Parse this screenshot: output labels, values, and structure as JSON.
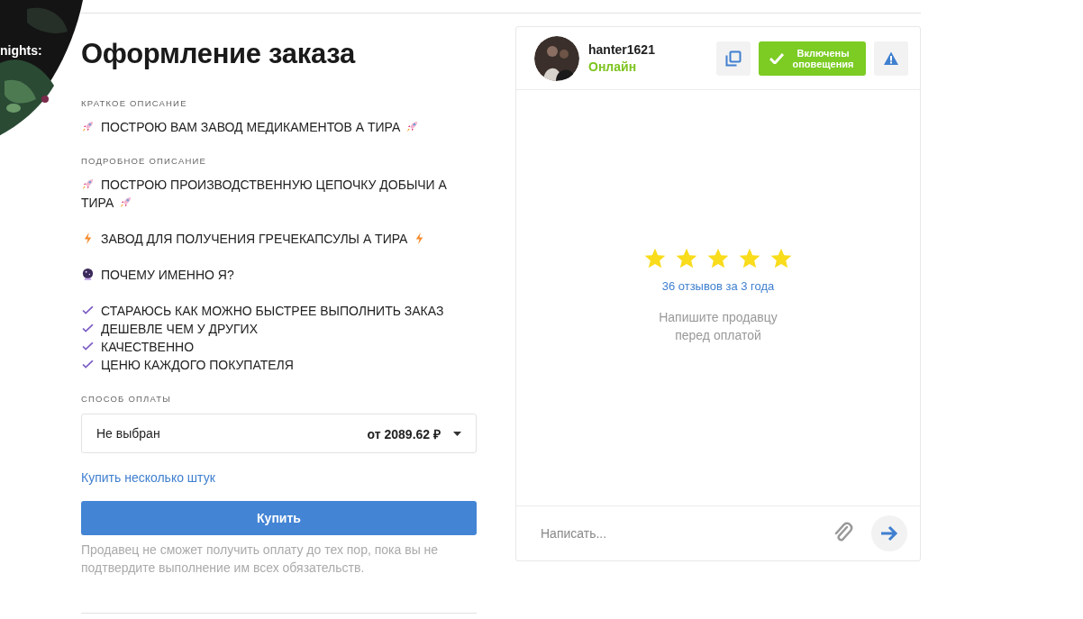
{
  "banner": {
    "kind": "picture",
    "caption": "nights:"
  },
  "order": {
    "title": "Оформление заказа",
    "short_label": "КРАТКОЕ ОПИСАНИЕ",
    "short": {
      "kind": "rocket",
      "text": "ПОСТРОЮ ВАМ ЗАВОД МЕДИКАМЕНТОВ А ТИРА",
      "trailing_icon": true
    },
    "detail_label": "ПОДРОБНОЕ ОПИСАНИЕ",
    "detail": [
      {
        "lines": [
          {
            "kind": "rocket",
            "text": "ПОСТРОЮ ПРОИЗВОДСТВЕННУЮ ЦЕПОЧКУ ДОБЫЧИ А ТИРА",
            "trailing_icon": true
          }
        ]
      },
      {
        "lines": [
          {
            "kind": "bolt",
            "text": "ЗАВОД ДЛЯ ПОЛУЧЕНИЯ ГРЕЧЕКАПСУЛЫ А ТИРА",
            "trailing_icon": true
          }
        ]
      },
      {
        "lines": [
          {
            "kind": "ball",
            "text": "ПОЧЕМУ ИМЕННО Я?",
            "trailing_icon": false
          }
        ]
      },
      {
        "lines": [
          {
            "kind": "check",
            "text": "СТАРАЮСЬ КАК МОЖНО БЫСТРЕЕ ВЫПОЛНИТЬ ЗАКАЗ",
            "trailing_icon": false
          },
          {
            "kind": "check",
            "text": "ДЕШЕВЛЕ ЧЕМ У ДРУГИХ",
            "trailing_icon": false
          },
          {
            "kind": "check",
            "text": "КАЧЕСТВЕННО",
            "trailing_icon": false
          },
          {
            "kind": "check",
            "text": "ЦЕНЮ КАЖДОГО ПОКУПАТЕЛЯ",
            "trailing_icon": false
          }
        ]
      }
    ],
    "payment_label": "СПОСОБ ОПЛАТЫ",
    "payment": {
      "value": "Не выбран",
      "price": "от 2089.62 ₽"
    },
    "multi_link": "Купить несколько штук",
    "buy_button": "Купить",
    "note": "Продавец не сможет получить оплату до тех пор, пока вы не подтвердите выполнение им всех обязательств."
  },
  "seller": {
    "name": "hanter1621",
    "status": "Онлайн",
    "notify_button": "Включены оповещения",
    "notifications_on": true,
    "stars": 5,
    "reviews_link": "36 отзывов за 3 года",
    "hint": "Напишите продавцу перед оплатой",
    "message_placeholder": "Написать..."
  }
}
